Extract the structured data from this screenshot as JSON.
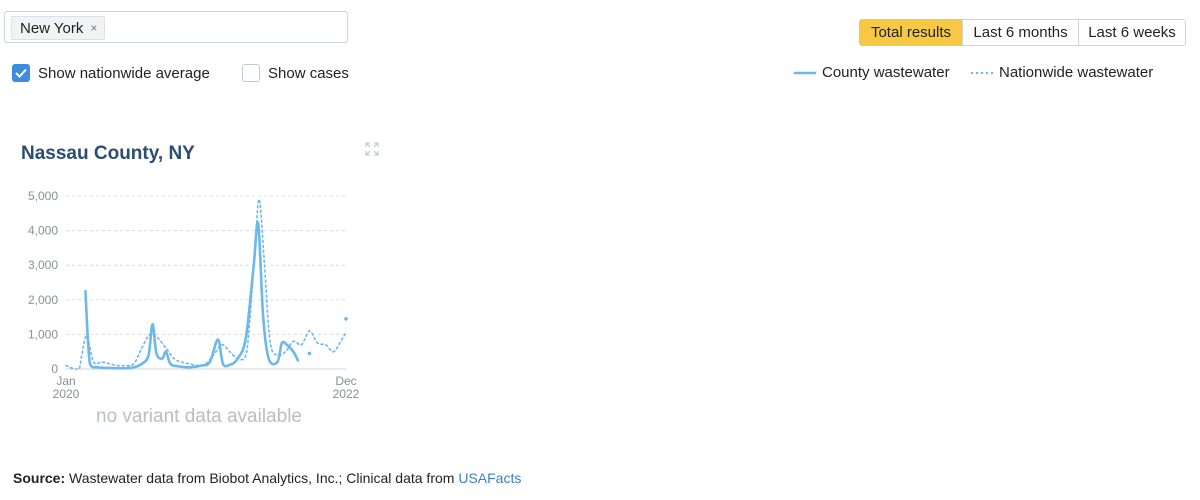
{
  "search": {
    "chip_label": "New York",
    "chip_remove": "×"
  },
  "range_tabs": [
    {
      "label": "Total results",
      "active": true
    },
    {
      "label": "Last 6 months",
      "active": false
    },
    {
      "label": "Last 6 weeks",
      "active": false
    }
  ],
  "options": {
    "nationwide_avg_label": "Show nationwide average",
    "nationwide_avg_checked": true,
    "cases_label": "Show cases",
    "cases_checked": false
  },
  "legend": {
    "county_label": "County wastewater",
    "nationwide_label": "Nationwide wastewater"
  },
  "colors": {
    "series": "#6cb8ec",
    "active_tab": "#f6c844",
    "title": "#2a4d74",
    "link": "#3b7fc4",
    "checkbox": "#3b8de0"
  },
  "no_variant_text": "no variant data available",
  "source": {
    "label": "Source:",
    "text": " Wastewater data from Biobot Analytics, Inc.; Clinical data from ",
    "link_text": "USAFacts"
  },
  "chart_data": {
    "type": "line",
    "title": "Nassau County, NY",
    "ylim": [
      0,
      5000
    ],
    "yticks": [
      0,
      1000,
      2000,
      3000,
      4000,
      5000
    ],
    "ytick_labels": [
      "0",
      "1,000",
      "2,000",
      "3,000",
      "4,000",
      "5,000"
    ],
    "xlim": [
      "2020-01",
      "2022-12"
    ],
    "xtick_labels": [
      {
        "month": "Jan",
        "year": "2020"
      },
      {
        "month": "Dec",
        "year": "2022"
      }
    ],
    "grid": true,
    "series": [
      {
        "name": "County wastewater",
        "style": "solid",
        "segments": [
          [
            [
              "2020-03-15",
              2250
            ],
            [
              "2020-04-01",
              150
            ],
            [
              "2020-05-01",
              50
            ],
            [
              "2020-06-15",
              30
            ],
            [
              "2020-08-01",
              20
            ],
            [
              "2020-09-15",
              50
            ],
            [
              "2020-10-15",
              150
            ],
            [
              "2020-11-10",
              400
            ],
            [
              "2020-11-25",
              1300
            ],
            [
              "2020-12-10",
              450
            ],
            [
              "2021-01-01",
              300
            ],
            [
              "2021-01-15",
              500
            ],
            [
              "2021-02-01",
              150
            ],
            [
              "2021-03-01",
              80
            ],
            [
              "2021-04-15",
              50
            ],
            [
              "2021-06-01",
              100
            ],
            [
              "2021-07-01",
              200
            ],
            [
              "2021-08-01",
              850
            ],
            [
              "2021-08-20",
              150
            ],
            [
              "2021-09-15",
              120
            ],
            [
              "2021-10-15",
              300
            ],
            [
              "2021-11-15",
              900
            ],
            [
              "2021-12-15",
              3000
            ],
            [
              "2022-01-01",
              4200
            ],
            [
              "2022-01-20",
              1500
            ],
            [
              "2022-02-10",
              300
            ],
            [
              "2022-03-15",
              200
            ],
            [
              "2022-04-01",
              750
            ],
            [
              "2022-04-20",
              700
            ],
            [
              "2022-05-15",
              500
            ],
            [
              "2022-06-01",
              250
            ]
          ]
        ]
      },
      {
        "name": "Nationwide wastewater",
        "style": "dotted",
        "points": [
          [
            "2020-01-01",
            100
          ],
          [
            "2020-02-01",
            0
          ],
          [
            "2020-02-20",
            0
          ],
          [
            "2020-03-01",
            400
          ],
          [
            "2020-03-20",
            950
          ],
          [
            "2020-04-15",
            200
          ],
          [
            "2020-05-15",
            200
          ],
          [
            "2020-06-15",
            150
          ],
          [
            "2020-07-15",
            100
          ],
          [
            "2020-08-15",
            100
          ],
          [
            "2020-09-15",
            150
          ],
          [
            "2020-10-15",
            600
          ],
          [
            "2020-11-15",
            1000
          ],
          [
            "2020-12-15",
            900
          ],
          [
            "2021-01-15",
            600
          ],
          [
            "2021-02-15",
            300
          ],
          [
            "2021-03-15",
            200
          ],
          [
            "2021-04-15",
            150
          ],
          [
            "2021-05-15",
            100
          ],
          [
            "2021-06-15",
            150
          ],
          [
            "2021-07-15",
            400
          ],
          [
            "2021-08-15",
            700
          ],
          [
            "2021-09-15",
            500
          ],
          [
            "2021-10-15",
            300
          ],
          [
            "2021-11-15",
            400
          ],
          [
            "2021-12-01",
            1500
          ],
          [
            "2021-12-20",
            3500
          ],
          [
            "2022-01-05",
            4900
          ],
          [
            "2022-01-25",
            3000
          ],
          [
            "2022-02-15",
            800
          ],
          [
            "2022-03-15",
            400
          ],
          [
            "2022-04-15",
            500
          ],
          [
            "2022-05-15",
            800
          ],
          [
            "2022-06-15",
            700
          ],
          [
            "2022-07-15",
            1100
          ],
          [
            "2022-08-15",
            750
          ],
          [
            "2022-09-15",
            700
          ],
          [
            "2022-10-15",
            500
          ],
          [
            "2022-11-15",
            850
          ],
          [
            "2022-12-01",
            1050
          ]
        ]
      }
    ],
    "isolated_points": [
      {
        "series": "County wastewater",
        "x": "2022-07-15",
        "y": 450
      },
      {
        "series": "County wastewater",
        "x": "2022-12-01",
        "y": 1450
      }
    ]
  }
}
